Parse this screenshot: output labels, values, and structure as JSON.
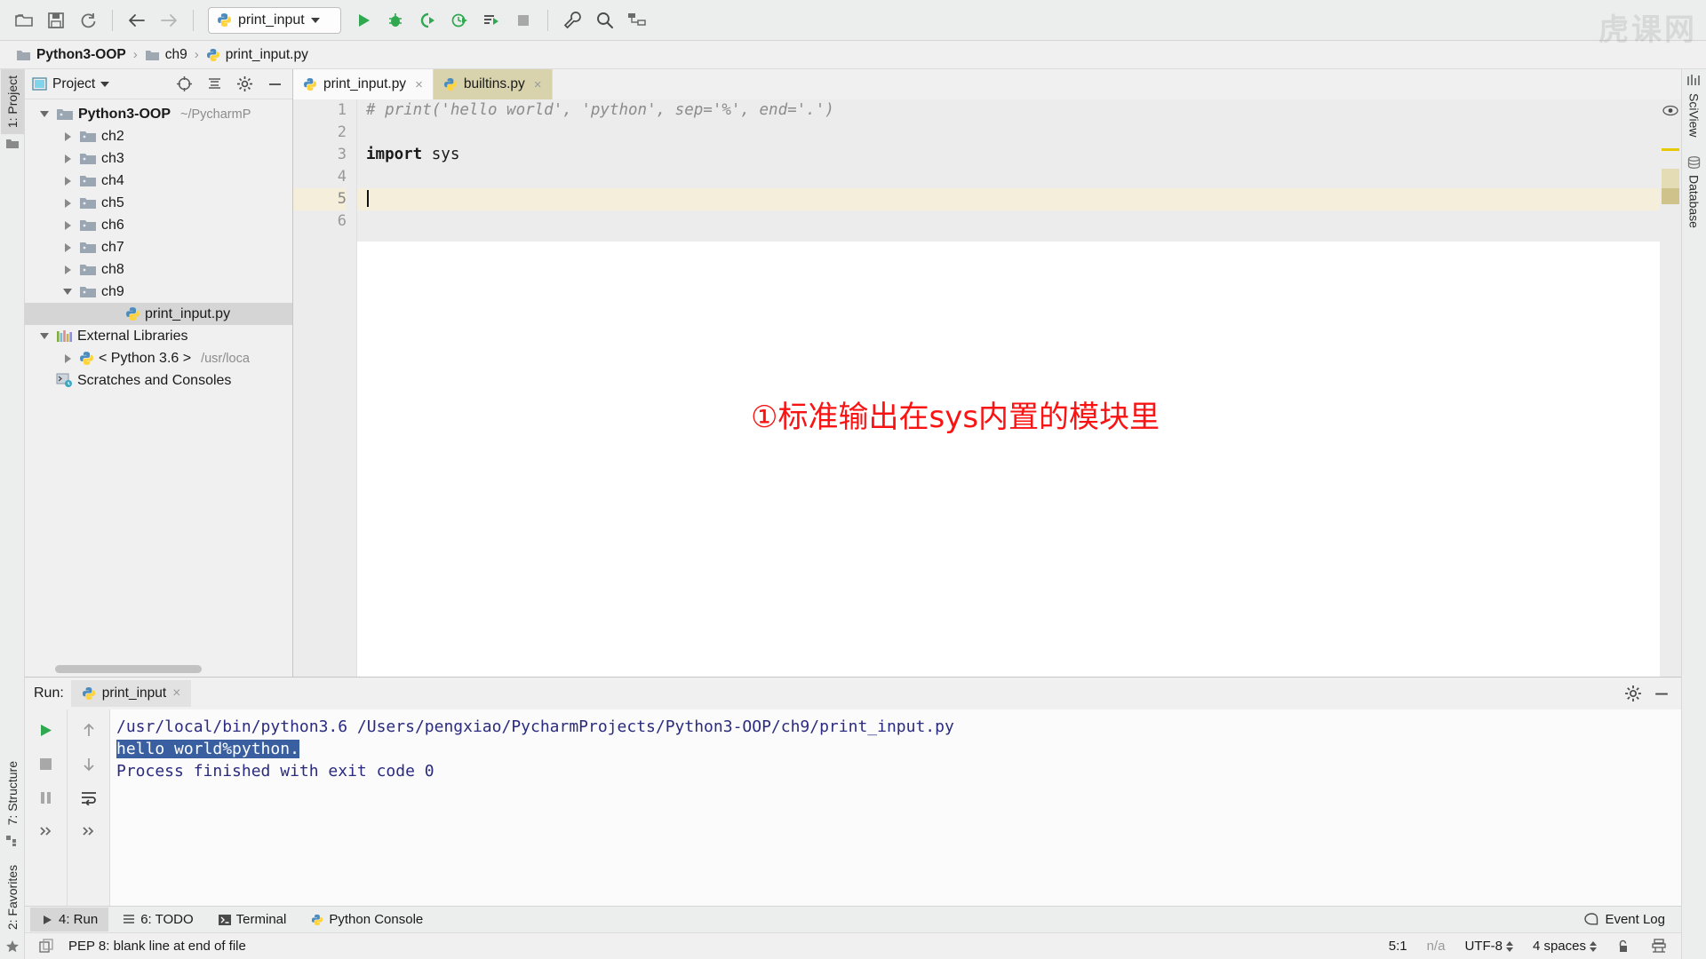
{
  "window": {
    "watermark": "虎课网"
  },
  "toolbar": {
    "open_icon": "folder-open-icon",
    "save_icon": "save-icon",
    "sync_icon": "refresh-icon",
    "back_icon": "arrow-left-icon",
    "forward_icon": "arrow-right-icon",
    "run_config": "print_input",
    "run_icon": "run-icon",
    "debug_icon": "debug-icon",
    "coverage_icon": "run-coverage-icon",
    "profile_icon": "profile-icon",
    "rerun_icon": "run-with-params-icon",
    "stop_icon": "stop-icon",
    "settings_icon": "wrench-icon",
    "search_icon": "search-icon",
    "layout_icon": "project-structure-icon"
  },
  "breadcrumb": {
    "items": [
      {
        "label": "Python3-OOP",
        "icon": "folder-icon",
        "bold": true
      },
      {
        "label": "ch9",
        "icon": "folder-icon",
        "bold": false
      },
      {
        "label": "print_input.py",
        "icon": "python-file-icon",
        "bold": false
      }
    ],
    "separator": "›"
  },
  "left_sidebar": {
    "project_tab": "1: Project",
    "structure_tab": "7: Structure",
    "favorites_tab": "2: Favorites"
  },
  "right_sidebar": {
    "sciview_tab": "SciView",
    "database_tab": "Database"
  },
  "project_panel": {
    "title": "Project",
    "locate_icon": "crosshair-icon",
    "collapse_icon": "collapse-all-icon",
    "settings_icon": "gear-icon",
    "hide_icon": "minimize-icon",
    "tree": [
      {
        "label": "Python3-OOP",
        "path": "~/PycharmP",
        "icon": "folder-icon",
        "arrow": "down",
        "indent": 0,
        "bold": true,
        "selected": false
      },
      {
        "label": "ch2",
        "path": "",
        "icon": "folder-icon",
        "arrow": "right",
        "indent": 1,
        "bold": false,
        "selected": false
      },
      {
        "label": "ch3",
        "path": "",
        "icon": "folder-icon",
        "arrow": "right",
        "indent": 1,
        "bold": false,
        "selected": false
      },
      {
        "label": "ch4",
        "path": "",
        "icon": "folder-icon",
        "arrow": "right",
        "indent": 1,
        "bold": false,
        "selected": false
      },
      {
        "label": "ch5",
        "path": "",
        "icon": "folder-icon",
        "arrow": "right",
        "indent": 1,
        "bold": false,
        "selected": false
      },
      {
        "label": "ch6",
        "path": "",
        "icon": "folder-icon",
        "arrow": "right",
        "indent": 1,
        "bold": false,
        "selected": false
      },
      {
        "label": "ch7",
        "path": "",
        "icon": "folder-icon",
        "arrow": "right",
        "indent": 1,
        "bold": false,
        "selected": false
      },
      {
        "label": "ch8",
        "path": "",
        "icon": "folder-icon",
        "arrow": "right",
        "indent": 1,
        "bold": false,
        "selected": false
      },
      {
        "label": "ch9",
        "path": "",
        "icon": "folder-icon",
        "arrow": "down",
        "indent": 1,
        "bold": false,
        "selected": false
      },
      {
        "label": "print_input.py",
        "path": "",
        "icon": "python-file-icon",
        "arrow": "none",
        "indent": 3,
        "bold": false,
        "selected": true
      },
      {
        "label": "External Libraries",
        "path": "",
        "icon": "libraries-icon",
        "arrow": "down",
        "indent": 0,
        "bold": false,
        "selected": false
      },
      {
        "label": "< Python 3.6 >",
        "path": "/usr/loca",
        "icon": "python-icon",
        "arrow": "right",
        "indent": 1,
        "bold": false,
        "selected": false
      },
      {
        "label": "Scratches and Consoles",
        "path": "",
        "icon": "scratches-icon",
        "arrow": "none",
        "indent": 0,
        "bold": false,
        "selected": false
      }
    ]
  },
  "editor": {
    "tabs": [
      {
        "label": "print_input.py",
        "icon": "python-file-icon",
        "active": true,
        "close": "×"
      },
      {
        "label": "builtins.py",
        "icon": "python-file-icon",
        "active": false,
        "close": "×"
      }
    ],
    "line_numbers": [
      "1",
      "2",
      "3",
      "4",
      "5",
      "6"
    ],
    "current_line": 5,
    "lines": [
      {
        "n": 1,
        "tokens": [
          {
            "t": "# print('hello world', 'python', sep='%', end='.')",
            "c": "cmt"
          }
        ]
      },
      {
        "n": 2,
        "tokens": []
      },
      {
        "n": 3,
        "tokens": [
          {
            "t": "import",
            "c": "kw"
          },
          {
            "t": " sys",
            "c": "idn"
          }
        ]
      },
      {
        "n": 4,
        "tokens": []
      },
      {
        "n": 5,
        "tokens": []
      },
      {
        "n": 6,
        "tokens": []
      }
    ],
    "annotation": "①标准输出在sys内置的模块里",
    "annotation_color": "#fa1313",
    "inspection_icon": "eye-icon"
  },
  "run_panel": {
    "label": "Run:",
    "tab": "print_input",
    "tab_close": "×",
    "settings_icon": "gear-icon",
    "hide_icon": "minimize-icon",
    "tools": [
      {
        "icon": "rerun-icon"
      },
      {
        "icon": "stop-icon"
      },
      {
        "icon": "pause-icon"
      },
      {
        "icon": "expand-more-icon"
      }
    ],
    "tools2": [
      {
        "icon": "arrow-up-icon"
      },
      {
        "icon": "arrow-down-icon"
      },
      {
        "icon": "soft-wrap-icon"
      },
      {
        "icon": "expand-more-icon"
      }
    ],
    "console": [
      {
        "text": "/usr/local/bin/python3.6 /Users/pengxiao/PycharmProjects/Python3-OOP/ch9/print_input.py",
        "selected": false
      },
      {
        "text": "hello world%python.",
        "selected": true
      },
      {
        "text": "Process finished with exit code 0",
        "selected": false
      }
    ]
  },
  "toolwindow_bar": {
    "items": [
      {
        "label": "4: Run",
        "mnemonic": "4",
        "icon": "run-icon",
        "selected": true
      },
      {
        "label": "6: TODO",
        "mnemonic": "6",
        "icon": "todo-icon",
        "selected": false
      },
      {
        "label": "Terminal",
        "mnemonic": "",
        "icon": "terminal-icon",
        "selected": false
      },
      {
        "label": "Python Console",
        "mnemonic": "",
        "icon": "python-icon",
        "selected": false
      }
    ],
    "event_log": "Event Log",
    "event_log_icon": "event-log-icon"
  },
  "statusbar": {
    "message": "PEP 8: blank line at end of file",
    "message_icon": "copy-icon",
    "caret_position": "5:1",
    "vcs": "n/a",
    "encoding": "UTF-8",
    "indent": "4 spaces",
    "lock_icon": "unlock-icon",
    "inspection_icon": "inspector-icon"
  }
}
